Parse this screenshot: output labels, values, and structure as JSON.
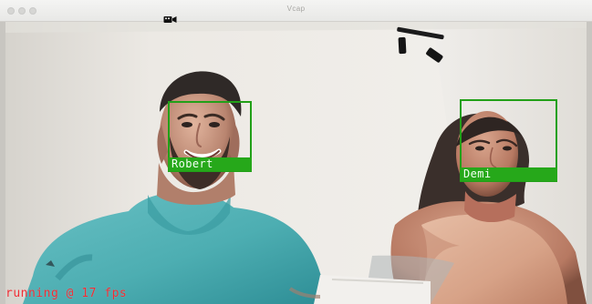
{
  "window": {
    "title": "Vcap"
  },
  "video": {
    "status_text": "running @ 17 fps"
  },
  "detections": [
    {
      "name": "Robert"
    },
    {
      "name": "Demi"
    }
  ],
  "colors": {
    "box": "#22a018",
    "label_bg": "#26a81a",
    "status": "#ef2d34"
  },
  "icons": {
    "window_control": "window-controls",
    "camera": "video-camera-icon"
  }
}
